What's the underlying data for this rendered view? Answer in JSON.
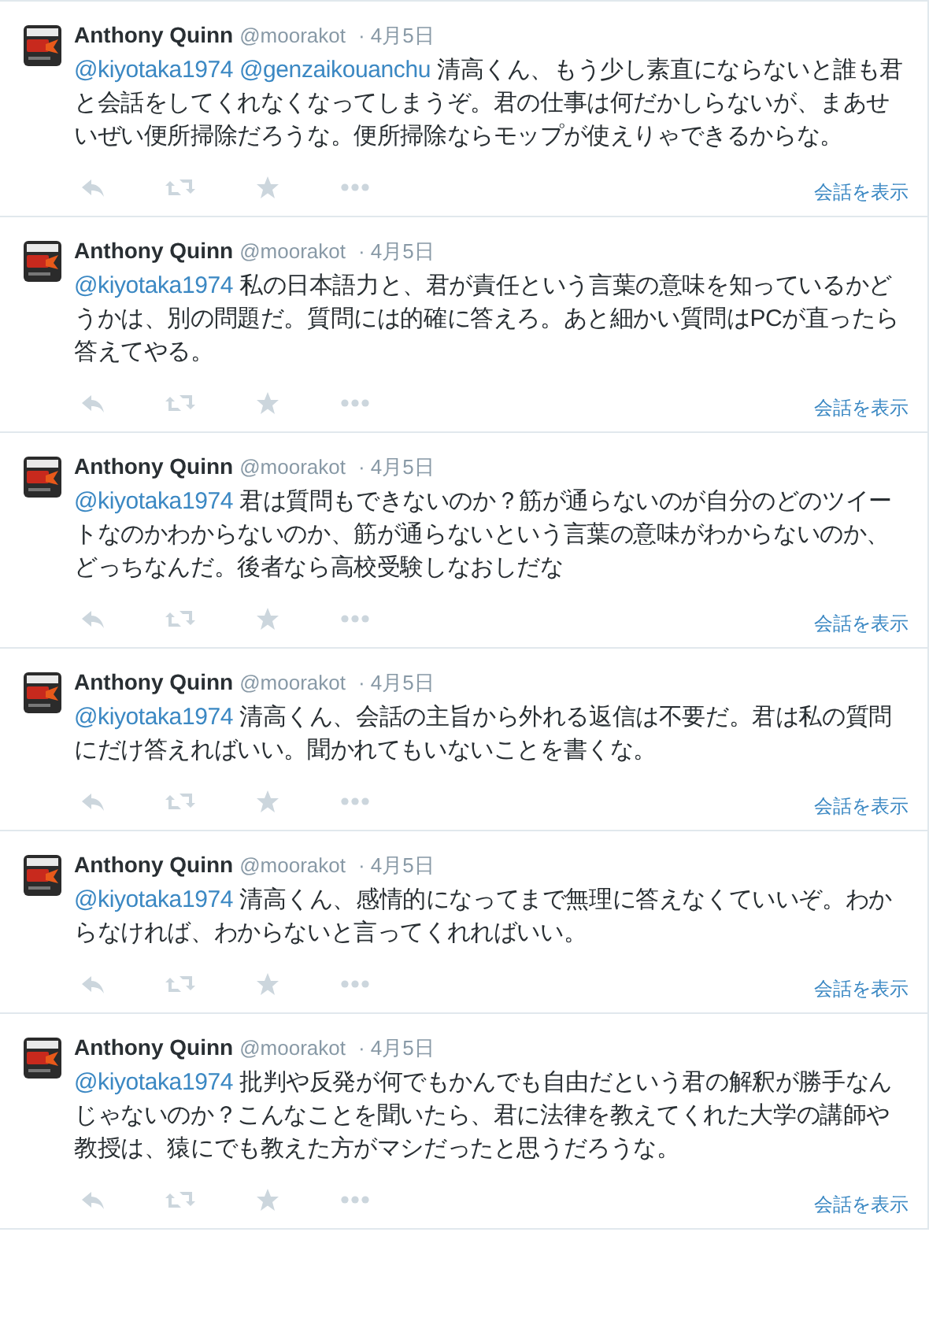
{
  "tweets": [
    {
      "name": "Anthony Quinn",
      "handle": "@moorakot",
      "date": "· 4月5日",
      "body": [
        {
          "kind": "mention",
          "text": "@kiyotaka1974"
        },
        {
          "kind": "mention",
          "text": "@genzaikouanchu"
        },
        {
          "kind": "text",
          "text": "清高くん、もう少し素直にならないと誰も君と会話をしてくれなくなってしまうぞ。君の仕事は何だかしらないが、まあせいぜい便所掃除だろうな。便所掃除ならモップが使えりゃできるからな。"
        }
      ],
      "link": "会話を表示"
    },
    {
      "name": "Anthony Quinn",
      "handle": "@moorakot",
      "date": "· 4月5日",
      "body": [
        {
          "kind": "mention",
          "text": "@kiyotaka1974"
        },
        {
          "kind": "text",
          "text": "私の日本語力と、君が責任という言葉の意味を知っているかどうかは、別の問題だ。質問には的確に答えろ。あと細かい質問はPCが直ったら答えてやる。"
        }
      ],
      "link": "会話を表示"
    },
    {
      "name": "Anthony Quinn",
      "handle": "@moorakot",
      "date": "· 4月5日",
      "body": [
        {
          "kind": "mention",
          "text": "@kiyotaka1974"
        },
        {
          "kind": "text",
          "text": "君は質問もできないのか？筋が通らないのが自分のどのツイートなのかわからないのか、筋が通らないという言葉の意味がわからないのか、どっちなんだ。後者なら高校受験しなおしだな"
        }
      ],
      "link": "会話を表示"
    },
    {
      "name": "Anthony Quinn",
      "handle": "@moorakot",
      "date": "· 4月5日",
      "body": [
        {
          "kind": "mention",
          "text": "@kiyotaka1974"
        },
        {
          "kind": "text",
          "text": "清高くん、会話の主旨から外れる返信は不要だ。君は私の質問にだけ答えればいい。聞かれてもいないことを書くな。"
        }
      ],
      "link": "会話を表示"
    },
    {
      "name": "Anthony Quinn",
      "handle": "@moorakot",
      "date": "· 4月5日",
      "body": [
        {
          "kind": "mention",
          "text": "@kiyotaka1974"
        },
        {
          "kind": "text",
          "text": "清高くん、感情的になってまで無理に答えなくていいぞ。わからなければ、わからないと言ってくれればいい。"
        }
      ],
      "link": "会話を表示"
    },
    {
      "name": "Anthony Quinn",
      "handle": "@moorakot",
      "date": "· 4月5日",
      "body": [
        {
          "kind": "mention",
          "text": "@kiyotaka1974"
        },
        {
          "kind": "text",
          "text": "批判や反発が何でもかんでも自由だという君の解釈が勝手なんじゃないのか？こんなことを聞いたら、君に法律を教えてくれた大学の講師や教授は、猿にでも教えた方がマシだったと思うだろうな。"
        }
      ],
      "link": "会話を表示"
    }
  ]
}
